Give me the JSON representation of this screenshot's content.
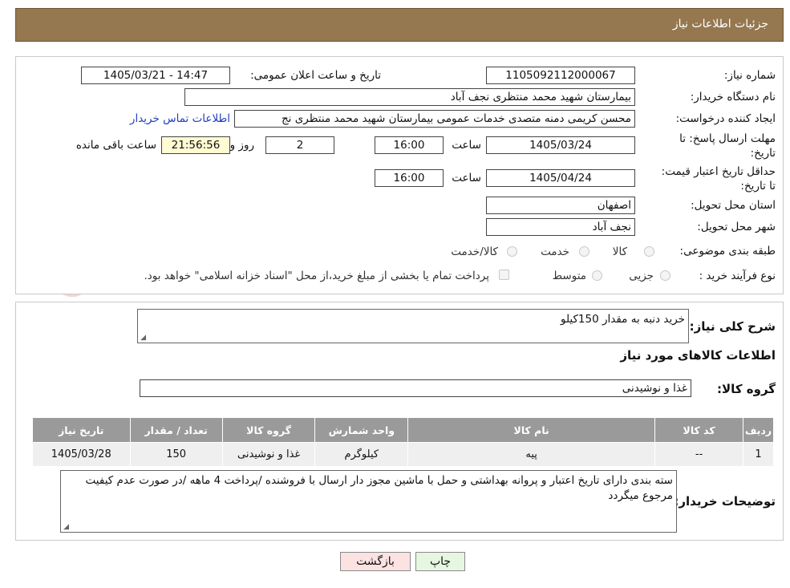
{
  "header": {
    "title": "جزئیات اطلاعات نیاز"
  },
  "watermark": {
    "text": "AriaTender.neT"
  },
  "form": {
    "need_number_label": "شماره نیاز:",
    "need_number": "1105092112000067",
    "announce_label": "تاریخ و ساعت اعلان عمومی:",
    "announce_value": "1405/03/21 - 14:47",
    "buyer_org_label": "نام دستگاه خریدار:",
    "buyer_org": "بیمارستان شهید محمد منتظری نجف آباد",
    "requester_label": "ایجاد کننده درخواست:",
    "requester": "محسن کریمی دمنه متصدی خدمات عمومی بیمارستان شهید محمد منتظری نج",
    "contact_link": "اطلاعات تماس خریدار",
    "deadline_label": "مهلت ارسال پاسخ: تا تاریخ:",
    "deadline_date": "1405/03/24",
    "time_label": "ساعت",
    "deadline_time": "16:00",
    "days_value": "2",
    "days_label": "روز و",
    "remaining_time": "21:56:56",
    "remaining_label": "ساعت باقی مانده",
    "price_validity_label": "حداقل تاریخ اعتبار قیمت: تا تاریخ:",
    "price_validity_date": "1405/04/24",
    "price_validity_time": "16:00",
    "province_label": "استان محل تحویل:",
    "province": "اصفهان",
    "city_label": "شهر محل تحویل:",
    "city": "نجف آباد",
    "category_label": "طبقه بندی موضوعی:",
    "category_options": [
      "کالا",
      "خدمت",
      "کالا/خدمت"
    ],
    "process_label": "نوع فرآیند خرید :",
    "process_options": [
      "جزیی",
      "متوسط"
    ],
    "payment_note": "پرداخت تمام یا بخشی از مبلغ خرید،از محل \"اسناد خزانه اسلامی\" خواهد بود."
  },
  "details": {
    "description_label": "شرح کلی نیاز:",
    "description": "خرید دنبه به مقدار 150کیلو",
    "goods_info_title": "اطلاعات کالاهای مورد نیاز",
    "goods_group_label": "گروه کالا:",
    "goods_group": "غذا و نوشیدنی",
    "table": {
      "headers": [
        "ردیف",
        "کد کالا",
        "نام کالا",
        "واحد شمارش",
        "گروه کالا",
        "تعداد / مقدار",
        "تاریخ نیاز"
      ],
      "rows": [
        [
          "1",
          "--",
          "پیه",
          "کیلوگرم",
          "غذا و نوشیدنی",
          "150",
          "1405/03/28"
        ]
      ]
    },
    "buyer_notes_label": "توضیحات خریدار:",
    "buyer_notes": "سته بندی دارای تاریخ اعتبار و پروانه بهداشتی و حمل با ماشین مجوز دار ارسال با فروشنده /پرداخت   4   ماهه /در صورت عدم کیفیت مرجوع میگردد"
  },
  "buttons": {
    "print": "چاپ",
    "back": "بازگشت"
  },
  "colors": {
    "header": "#957750",
    "link": "#1d3fbf",
    "back_button": "#fde2e2",
    "print_button": "#e6f7e1"
  }
}
